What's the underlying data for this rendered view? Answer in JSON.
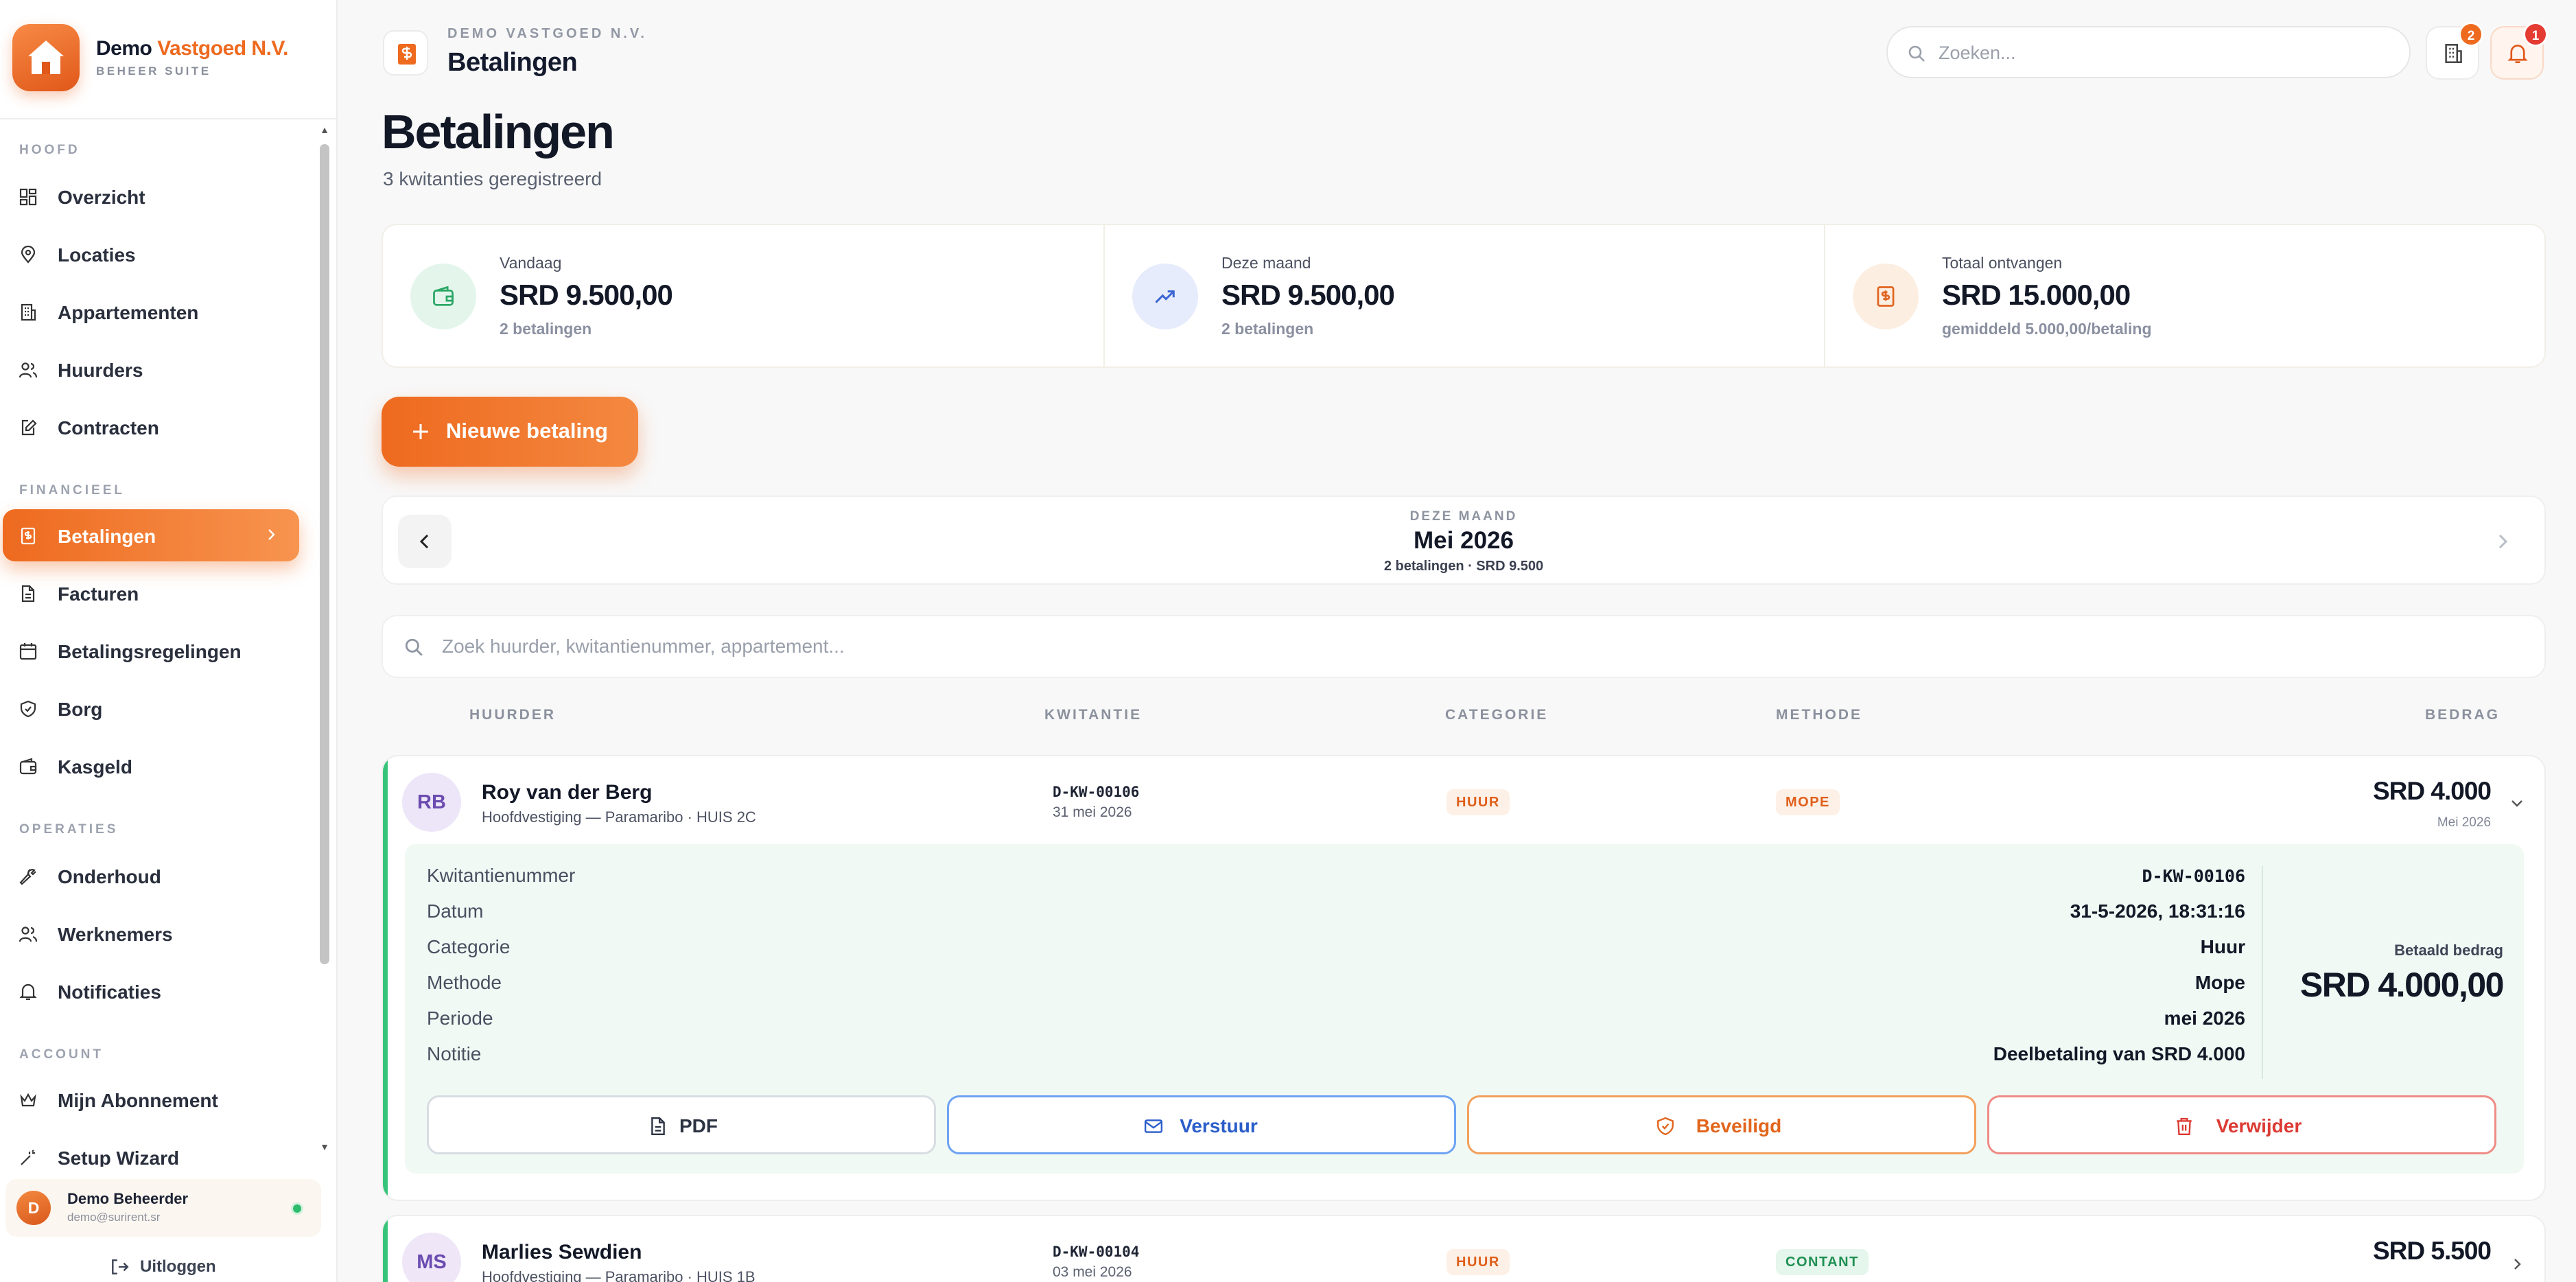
{
  "brand": {
    "name_primary": "Demo",
    "name_accent": "Vastgoed N.V.",
    "subtitle": "BEHEER SUITE"
  },
  "sidebar": {
    "sections": {
      "hoofd": "HOOFD",
      "financieel": "FINANCIEEL",
      "operaties": "OPERATIES",
      "account": "ACCOUNT"
    },
    "items": [
      {
        "label": "Overzicht",
        "icon": "dashboard-icon"
      },
      {
        "label": "Locaties",
        "icon": "map-pin-icon"
      },
      {
        "label": "Appartementen",
        "icon": "building-icon"
      },
      {
        "label": "Huurders",
        "icon": "users-icon"
      },
      {
        "label": "Contracten",
        "icon": "file-edit-icon"
      },
      {
        "label": "Betalingen",
        "icon": "receipt-icon",
        "active": true
      },
      {
        "label": "Facturen",
        "icon": "document-icon"
      },
      {
        "label": "Betalingsregelingen",
        "icon": "calendar-icon"
      },
      {
        "label": "Borg",
        "icon": "shield-icon"
      },
      {
        "label": "Kasgeld",
        "icon": "wallet-icon"
      },
      {
        "label": "Onderhoud",
        "icon": "wrench-icon"
      },
      {
        "label": "Werknemers",
        "icon": "users-icon"
      },
      {
        "label": "Notificaties",
        "icon": "bell-icon"
      },
      {
        "label": "Mijn Abonnement",
        "icon": "crown-icon"
      },
      {
        "label": "Setup Wizard",
        "icon": "wand-icon"
      }
    ],
    "user": {
      "initial": "D",
      "name": "Demo Beheerder",
      "email": "demo@surirent.sr",
      "status": "online"
    },
    "logout": "Uitloggen"
  },
  "header": {
    "company": "DEMO VASTGOED N.V.",
    "title": "Betalingen",
    "search_placeholder": "Zoeken...",
    "building_badge": "2",
    "bell_badge": "1"
  },
  "page": {
    "title": "Betalingen",
    "subtitle": "3 kwitanties geregistreerd"
  },
  "stats": [
    {
      "label": "Vandaag",
      "value": "SRD 9.500,00",
      "sub": "2 betalingen",
      "icon": "wallet-icon",
      "color": "#e4f6ec"
    },
    {
      "label": "Deze maand",
      "value": "SRD 9.500,00",
      "sub": "2 betalingen",
      "icon": "trending-up-icon",
      "color": "#e6ecfb"
    },
    {
      "label": "Totaal ontvangen",
      "value": "SRD 15.000,00",
      "sub": "gemiddeld 5.000,00/betaling",
      "icon": "receipt-icon",
      "color": "#fdeee2"
    }
  ],
  "new_payment": "Nieuwe betaling",
  "month": {
    "label": "DEZE MAAND",
    "value": "Mei 2026",
    "stats": "2 betalingen · SRD 9.500"
  },
  "filter_placeholder": "Zoek huurder, kwitantienummer, appartement...",
  "table": {
    "headers": {
      "tenant": "HUURDER",
      "receipt": "KWITANTIE",
      "category": "CATEGORIE",
      "method": "METHODE",
      "amount": "BEDRAG"
    },
    "rows": [
      {
        "initials": "RB",
        "name": "Roy van der Berg",
        "location": "Hoofdvestiging — Paramaribo · HUIS 2C",
        "receipt": "D-KW-00106",
        "date": "31 mei 2026",
        "category": "HUUR",
        "method": "MOPE",
        "amount": "SRD 4.000",
        "period": "Mei 2026",
        "expanded": true,
        "details": {
          "keys": [
            "Kwitantienummer",
            "Datum",
            "Categorie",
            "Methode",
            "Periode",
            "Notitie"
          ],
          "values": [
            "D-KW-00106",
            "31-5-2026, 18:31:16",
            "Huur",
            "Mope",
            "mei 2026",
            "Deelbetaling van SRD 4.000"
          ],
          "paid_label": "Betaald bedrag",
          "paid_value": "SRD 4.000,00"
        },
        "actions": {
          "pdf": "PDF",
          "send": "Verstuur",
          "secure": "Beveiligd",
          "delete": "Verwijder"
        }
      },
      {
        "initials": "MS",
        "name": "Marlies Sewdien",
        "location": "Hoofdvestiging — Paramaribo · HUIS 1B",
        "receipt": "D-KW-00104",
        "date": "03 mei 2026",
        "category": "HUUR",
        "method": "CONTANT",
        "amount": "SRD 5.500",
        "expanded": false
      }
    ]
  },
  "colors": {
    "accent": "#ee6a1f",
    "success": "#36c47a",
    "danger": "#dc3a33",
    "link": "#2a5dc9"
  }
}
